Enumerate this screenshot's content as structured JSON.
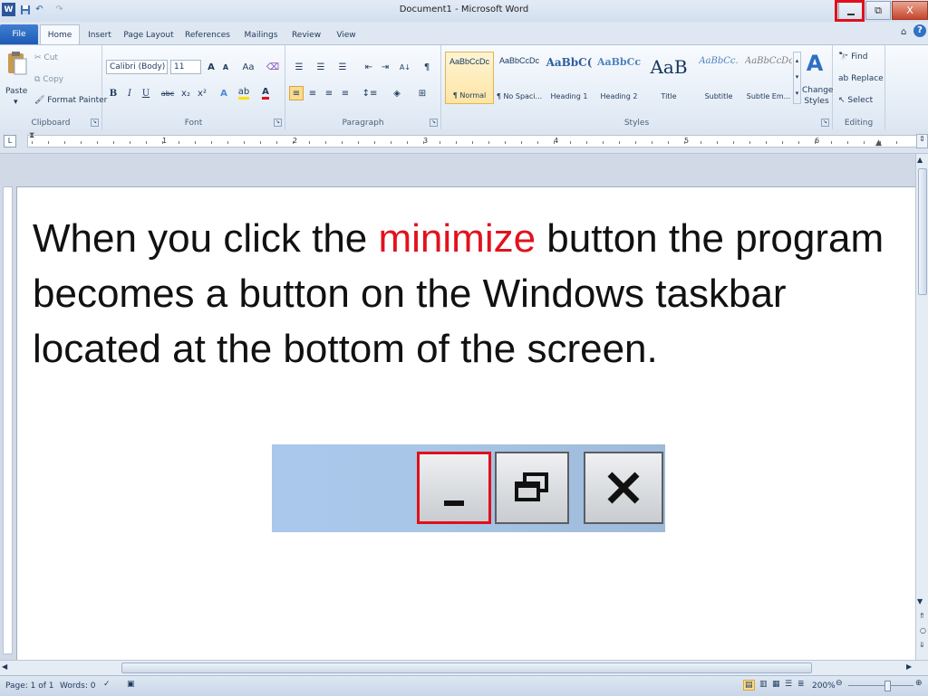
{
  "window": {
    "title": "Document1 - Microsoft Word",
    "controls": {
      "minimize": "▭",
      "restore": "⧉",
      "close": "X"
    }
  },
  "quick_access": {
    "word_icon": "W",
    "save_icon": "save-icon",
    "undo_icon": "↶",
    "redo_icon": "↷"
  },
  "tabs": [
    "File",
    "Home",
    "Insert",
    "Page Layout",
    "References",
    "Mailings",
    "Review",
    "View"
  ],
  "ribbon": {
    "clipboard": {
      "label": "Clipboard",
      "paste": "Paste",
      "cut": "Cut",
      "copy": "Copy",
      "format_painter": "Format Painter"
    },
    "font": {
      "label": "Font",
      "font_name": "Calibri (Body)",
      "font_size": "11",
      "grow": "A",
      "shrink": "A",
      "change_case": "Aa",
      "bold": "B",
      "italic": "I",
      "underline": "U",
      "strike": "abc",
      "subscript": "x₂",
      "superscript": "x²"
    },
    "paragraph": {
      "label": "Paragraph",
      "pilcrow": "¶"
    },
    "styles": {
      "label": "Styles",
      "items": [
        {
          "preview": "AaBbCcDc",
          "name": "¶ Normal"
        },
        {
          "preview": "AaBbCcDc",
          "name": "¶ No Spaci..."
        },
        {
          "preview": "AaBbC(",
          "name": "Heading 1"
        },
        {
          "preview": "AaBbCc",
          "name": "Heading 2"
        },
        {
          "preview": "AaB",
          "name": "Title"
        },
        {
          "preview": "AaBbCc.",
          "name": "Subtitle"
        },
        {
          "preview": "AaBbCcDc",
          "name": "Subtle Em..."
        }
      ],
      "change_styles": "Change Styles"
    },
    "editing": {
      "label": "Editing",
      "find": "Find",
      "replace": "Replace",
      "select": "Select"
    }
  },
  "ruler": {
    "numbers": [
      "1",
      "2",
      "3",
      "4",
      "5",
      "6"
    ]
  },
  "document": {
    "text_before": "When you click the ",
    "text_highlight": "minimize",
    "text_after": " button the program becomes a button on the Windows taskbar located at the bottom of the screen.",
    "highlight_color": "#e1121e"
  },
  "status": {
    "page": "Page: 1 of 1",
    "words": "Words: 0",
    "zoom": "200%"
  }
}
